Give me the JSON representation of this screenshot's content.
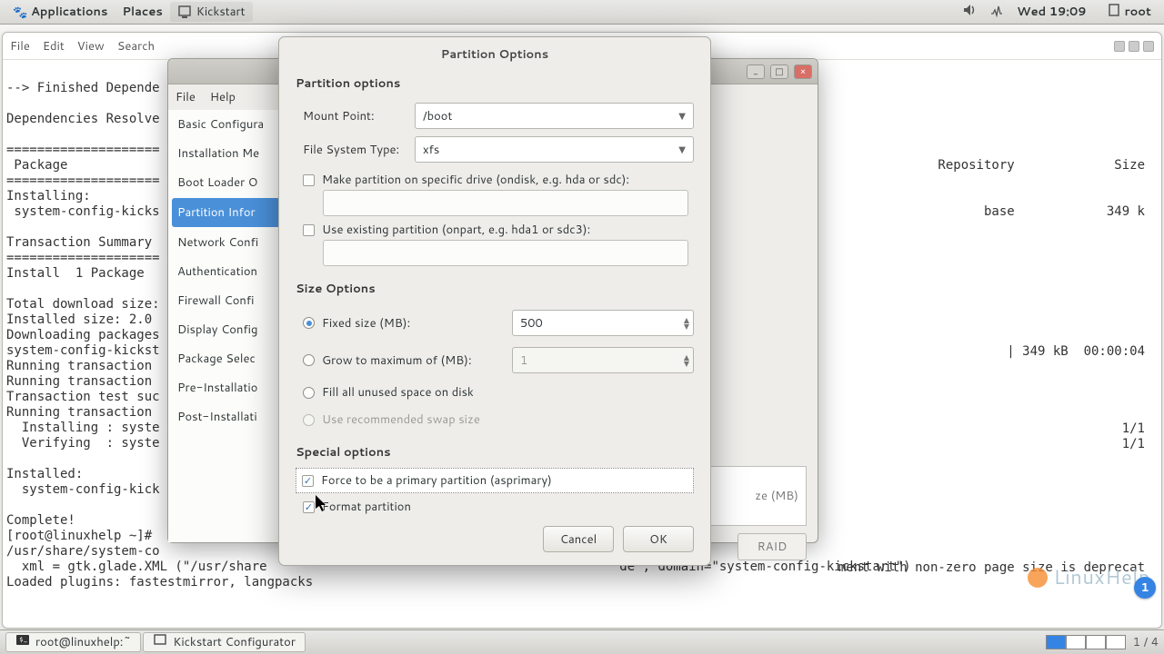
{
  "panel": {
    "applications": "Applications",
    "places": "Places",
    "active_app": "Kickstart",
    "clock": "Wed 19:09",
    "user": "root"
  },
  "terminal": {
    "menus": [
      "File",
      "Edit",
      "View",
      "Search"
    ],
    "header_package": "Package",
    "header_repository": "Repository",
    "header_size": "Size",
    "lines": "--> Finished Depende\n\nDependencies Resolve\n\n====================\n Package\n====================\nInstalling:\n system-config-kicks\n\nTransaction Summary\n====================\nInstall  1 Package\n\nTotal download size:\nInstalled size: 2.0\nDownloading packages\nsystem-config-kickst\nRunning transaction\nRunning transaction\nTransaction test suc\nRunning transaction\n  Installing : syste\n  Verifying  : syste\n\nInstalled:\n  system-config-kick\n\nComplete!\n[root@linuxhelp ~]#\n/usr/share/system-co\n  xml = gtk.glade.XML (\"/usr/share                                              de\", domain=\"system-config-kickstart\")\nLoaded plugins: fastestmirror, langpacks\n",
    "right_side": {
      "head_line": "=====================================",
      "repo_val": "base",
      "size_val": "349 k",
      "dl_line": "| 349 kB  00:00:04",
      "fraction": "1/1",
      "deprec": "ment with non-zero page size is deprecat"
    },
    "watermark": "LinuxHelp",
    "notif_count": "1"
  },
  "taskbar": {
    "task1": "root@linuxhelp:~",
    "task2": "Kickstart Configurator",
    "pager": "1 / 4"
  },
  "kickstart": {
    "menus": [
      "File",
      "Help"
    ],
    "sidebar": [
      "Basic Configura",
      "Installation Me",
      "Boot Loader O",
      "Partition Infor",
      "Network Confi",
      "Authentication",
      "Firewall Confi",
      "Display Config",
      "Package Selec",
      "Pre-Installatio",
      "Post-Installati"
    ],
    "table_col": "ze (MB)",
    "raid": "RAID"
  },
  "dialog": {
    "title": "Partition Options",
    "h_partition": "Partition options",
    "lbl_mount": "Mount Point:",
    "val_mount": "/boot",
    "lbl_fstype": "File System Type:",
    "val_fstype": "xfs",
    "cb_ondisk": "Make partition on specific drive (ondisk, e.g. hda or sdc):",
    "cb_onpart": "Use existing partition (onpart, e.g. hda1 or sdc3):",
    "h_size": "Size Options",
    "r_fixed": "Fixed size (MB):",
    "v_fixed": "500",
    "r_grow": "Grow to maximum of (MB):",
    "v_grow": "1",
    "r_fill": "Fill all unused space on disk",
    "r_rec": "Use recommended swap size",
    "h_special": "Special options",
    "cb_primary": "Force to be a primary partition (asprimary)",
    "cb_format": "Format partition",
    "btn_cancel": "Cancel",
    "btn_ok": "OK"
  }
}
